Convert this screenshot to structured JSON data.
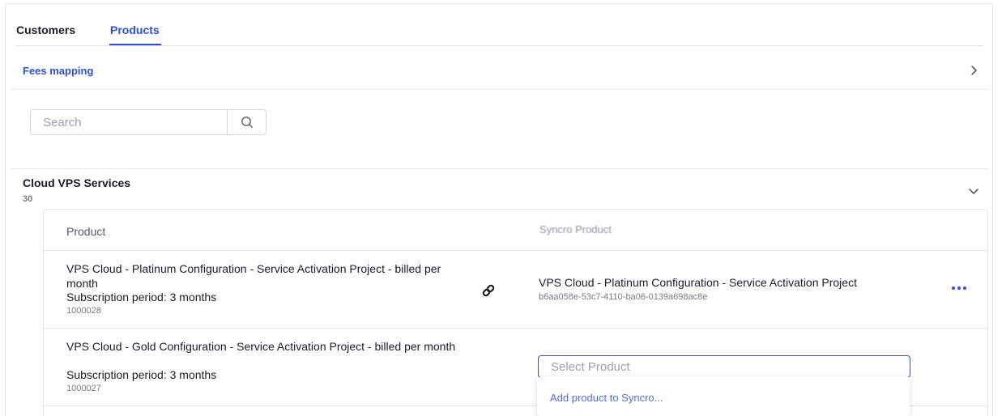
{
  "tabs": [
    {
      "label": "Customers",
      "active": false
    },
    {
      "label": "Products",
      "active": true
    }
  ],
  "fees": {
    "label": "Fees mapping",
    "icon": "chevron-right-icon"
  },
  "search": {
    "placeholder": "Search",
    "value": "",
    "icon": "search-icon"
  },
  "group": {
    "title": "Cloud VPS Services",
    "count": "30",
    "icon": "chevron-down-icon"
  },
  "table": {
    "headers": {
      "product": "Product",
      "syncro_product": "Syncro Product"
    },
    "rows": [
      {
        "name": "VPS Cloud - Platinum Configuration - Service Activation Project - billed per month",
        "period": "Subscription period: 3 months",
        "id": "1000028",
        "link_icon": "link-icon",
        "mapped_name": "VPS Cloud - Platinum Configuration - Service Activation Project",
        "mapped_id": "b6aa058e-53c7-4110-ba06-0139a698ac8e",
        "menu_icon": "more-horizontal-icon"
      },
      {
        "name": "VPS Cloud - Gold Configuration - Service Activation Project - billed per month",
        "period": "Subscription period: 3 months",
        "id": "1000027",
        "select_placeholder": "Select Product",
        "select_value": ""
      }
    ]
  },
  "dropdown": {
    "items": [
      {
        "label": "Add product to Syncro..."
      }
    ]
  },
  "colors": {
    "accent": "#2f4ed8",
    "text": "#1b1b28",
    "muted": "#777a88",
    "border": "#e2e3ea"
  }
}
